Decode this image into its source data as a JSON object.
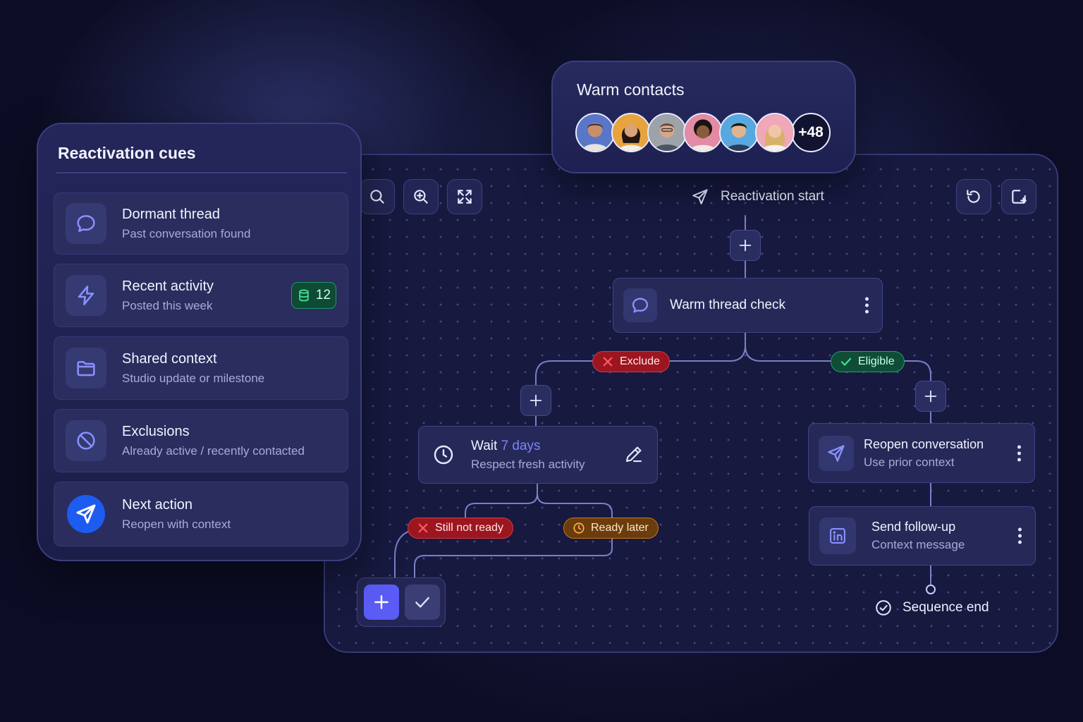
{
  "cues_panel": {
    "title": "Reactivation cues",
    "items": [
      {
        "title": "Dormant thread",
        "subtitle": "Past conversation found",
        "icon": "chat-bubble-icon"
      },
      {
        "title": "Recent activity",
        "subtitle": "Posted this week",
        "icon": "lightning-icon",
        "badge": "12",
        "badge_icon": "database-icon"
      },
      {
        "title": "Shared context",
        "subtitle": "Studio update or milestone",
        "icon": "folder-icon"
      },
      {
        "title": "Exclusions",
        "subtitle": "Already active / recently contacted",
        "icon": "prohibited-icon"
      },
      {
        "title": "Next action",
        "subtitle": "Reopen with context",
        "icon": "send-icon"
      }
    ]
  },
  "warm_contacts": {
    "title": "Warm contacts",
    "more_count": "+48",
    "avatar_count": 6
  },
  "canvas": {
    "toolbar_left": [
      "search-icon",
      "zoom-in-icon",
      "fullscreen-icon"
    ],
    "toolbar_right": [
      "undo-icon",
      "add-note-icon"
    ],
    "start_label": "Reactivation start",
    "start_icon": "send-outline-icon",
    "check_node": {
      "title": "Warm thread check",
      "icon": "chat-bubble-icon"
    },
    "branches": {
      "exclude": "Exclude",
      "eligible": "Eligible"
    },
    "wait_node": {
      "title_prefix": "Wait",
      "title_accent": "7 days",
      "subtitle": "Respect fresh activity",
      "icon": "clock-icon",
      "action_icon": "pencil-icon"
    },
    "wait_branches": {
      "not_ready": "Still not ready",
      "ready_later": "Ready later"
    },
    "reopen_node": {
      "title": "Reopen conversation",
      "subtitle": "Use prior context",
      "icon": "send-icon"
    },
    "followup_node": {
      "title": "Send follow-up",
      "subtitle": "Context message",
      "icon": "linkedin-icon"
    },
    "end_label": "Sequence end",
    "end_icon": "check-circle-icon"
  },
  "colors": {
    "accent": "#5b5cf5",
    "danger": "#9c1620",
    "success": "#0f4d36",
    "warning": "#6b3c0c",
    "background": "#0c0d24"
  }
}
